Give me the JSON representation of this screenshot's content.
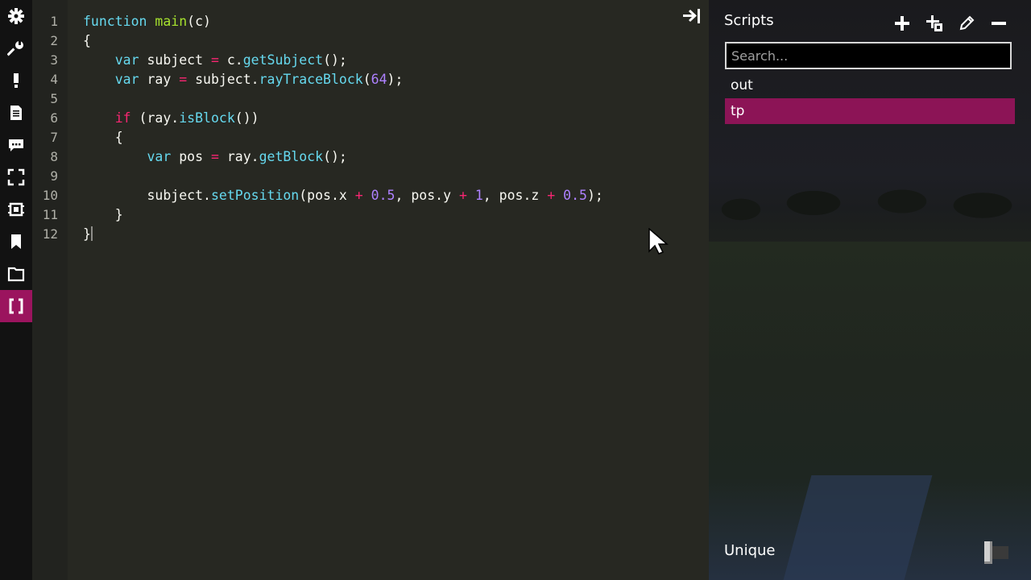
{
  "sidebar": {
    "items": [
      {
        "name": "gear-icon"
      },
      {
        "name": "wrench-icon"
      },
      {
        "name": "exclamation-icon"
      },
      {
        "name": "document-icon"
      },
      {
        "name": "chat-icon"
      },
      {
        "name": "fullscreen-icon"
      },
      {
        "name": "chip-icon"
      },
      {
        "name": "bookmark-icon"
      },
      {
        "name": "folder-icon"
      },
      {
        "name": "brackets-icon",
        "active": true
      }
    ]
  },
  "editor": {
    "line_numbers": [
      "1",
      "2",
      "3",
      "4",
      "5",
      "6",
      "7",
      "8",
      "9",
      "10",
      "11",
      "12"
    ],
    "code": {
      "l1": {
        "kw": "function",
        "sp": " ",
        "fn": "main",
        "rest": "(c)"
      },
      "l2": {
        "text": "{"
      },
      "l3": {
        "indent": "    ",
        "kw": "var",
        "a": " subject ",
        "op": "=",
        "b": " c.",
        "m": "getSubject",
        "c": "();"
      },
      "l4": {
        "indent": "    ",
        "kw": "var",
        "a": " ray ",
        "op": "=",
        "b": " subject.",
        "m": "rayTraceBlock",
        "p": "(",
        "n": "64",
        "c": ");"
      },
      "l5": {
        "text": ""
      },
      "l6": {
        "indent": "    ",
        "kw": "if",
        "a": " (ray.",
        "m": "isBlock",
        "c": "())"
      },
      "l7": {
        "indent": "    ",
        "text": "{"
      },
      "l8": {
        "indent": "        ",
        "kw": "var",
        "a": " pos ",
        "op": "=",
        "b": " ray.",
        "m": "getBlock",
        "c": "();"
      },
      "l9": {
        "text": ""
      },
      "l10": {
        "indent": "        ",
        "a": "subject.",
        "m": "setPosition",
        "b": "(pos.x ",
        "op1": "+",
        "s1": " ",
        "n1": "0.5",
        "c1": ", pos.y ",
        "op2": "+",
        "s2": " ",
        "n2": "1",
        "c2": ", pos.z ",
        "op3": "+",
        "s3": " ",
        "n3": "0.5",
        "c3": ");"
      },
      "l11": {
        "indent": "    ",
        "text": "}"
      },
      "l12": {
        "text": "}"
      }
    }
  },
  "panel": {
    "title": "Scripts",
    "tools": [
      "plus-icon",
      "duplicate-icon",
      "pencil-icon",
      "minus-icon"
    ],
    "search_placeholder": "Search...",
    "scripts": [
      {
        "label": "out",
        "selected": false
      },
      {
        "label": "tp",
        "selected": true
      }
    ],
    "unique_label": "Unique",
    "unique_enabled": false
  },
  "colors": {
    "accent": "#9b145e",
    "selected": "#8c1456",
    "editor_bg": "#272822"
  }
}
